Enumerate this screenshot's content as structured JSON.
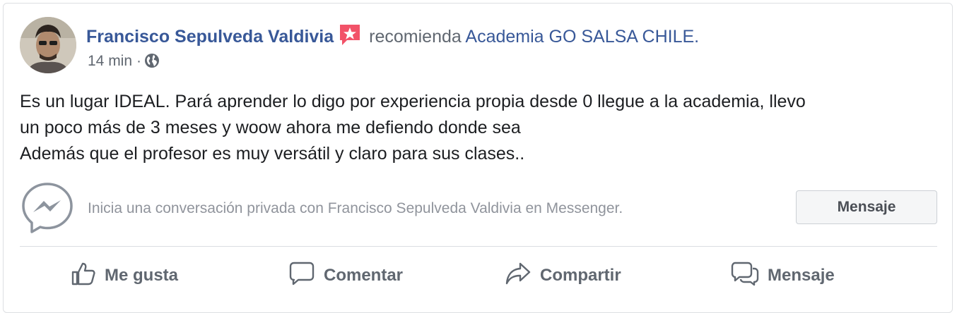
{
  "post": {
    "author_name": "Francisco Sepulveda Valdivia",
    "recommend_text": "recomienda",
    "page_name": "Academia GO SALSA CHILE.",
    "time": "14 min",
    "separator": "·",
    "privacy_icon": "globe-icon",
    "badge_icon": "recommendation-star-icon",
    "text_lines": [
      "Es un lugar IDEAL. Pará aprender lo digo por experiencia propia desde 0 llegue a la academia, llevo",
      "un poco más de 3 meses y woow ahora me defiendo donde sea",
      "Además que el profesor es muy versátil y claro para sus clases.."
    ]
  },
  "messenger": {
    "icon": "messenger-icon",
    "prompt": "Inicia una conversación privada con Francisco Sepulveda Valdivia en Messenger.",
    "button_label": "Mensaje"
  },
  "actions": [
    {
      "label": "Me gusta",
      "icon": "thumbs-up-icon"
    },
    {
      "label": "Comentar",
      "icon": "comment-icon"
    },
    {
      "label": "Compartir",
      "icon": "share-icon"
    },
    {
      "label": "Mensaje",
      "icon": "message-icon"
    }
  ],
  "colors": {
    "link": "#385898",
    "badge": "#f25268",
    "secondary_text": "#606770",
    "muted_text": "#90949c",
    "border": "#dddfe2"
  }
}
